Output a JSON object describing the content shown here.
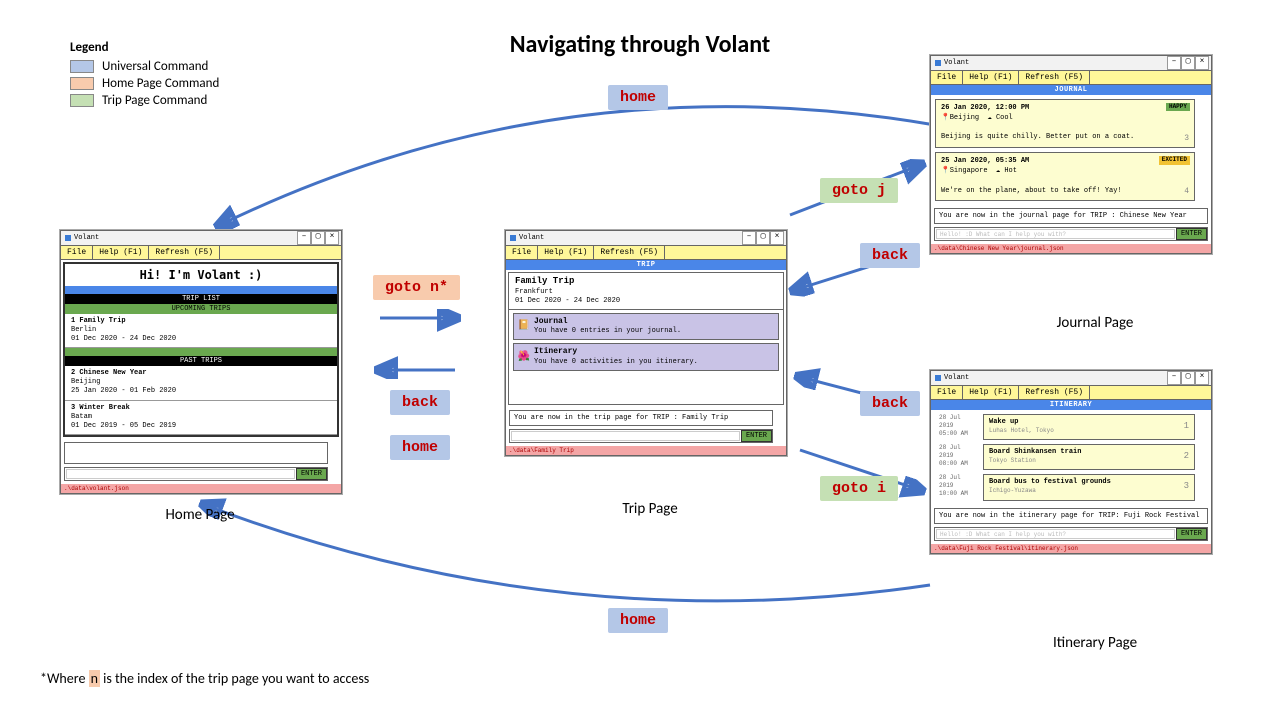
{
  "title": "Navigating through Volant",
  "legend": {
    "heading": "Legend",
    "items": [
      {
        "label": "Universal Command",
        "color": "#b4c7e7"
      },
      {
        "label": "Home Page Command",
        "color": "#f8cbad"
      },
      {
        "label": "Trip Page Command",
        "color": "#c5e0b4"
      }
    ]
  },
  "commands": {
    "home1": "home",
    "goto_n": "goto n*",
    "back1": "back",
    "home2": "home",
    "goto_j": "goto j",
    "back2": "back",
    "back3": "back",
    "goto_i": "goto i",
    "home3": "home"
  },
  "captions": {
    "home": "Home Page",
    "trip": "Trip Page",
    "journal": "Journal Page",
    "itin": "Itinerary Page"
  },
  "footnote": {
    "prefix": "*Where ",
    "n": "n",
    "suffix": " is the index of the trip page you want to access"
  },
  "app": {
    "name": "Volant",
    "menus": {
      "file": "File",
      "help": "Help (F1)",
      "refresh": "Refresh (F5)"
    },
    "enter": "ENTER"
  },
  "home_win": {
    "greeting": "Hi! I'm Volant :)",
    "trip_list": "TRIP LIST",
    "upcoming": "UPCOMING TRIPS",
    "past": "PAST TRIPS",
    "trips": [
      {
        "idx": "1",
        "name": "Family Trip",
        "place": "Berlin",
        "dates": "01 Dec 2020 - 24 Dec 2020"
      },
      {
        "idx": "2",
        "name": "Chinese New Year",
        "place": "Beijing",
        "dates": "25 Jan 2020 - 01 Feb 2020"
      },
      {
        "idx": "3",
        "name": "Winter Break",
        "place": "Batam",
        "dates": "01 Dec 2019 - 05 Dec 2019"
      }
    ],
    "path": ".\\data\\volant.json"
  },
  "trip_win": {
    "tab": "TRIP",
    "name": "Family Trip",
    "place": "Frankfurt",
    "dates": "01 Dec 2020 - 24 Dec 2020",
    "journal_title": "Journal",
    "journal_sub": "You have 0 entries in your journal.",
    "itin_title": "Itinerary",
    "itin_sub": "You have 0 activities in you itinerary.",
    "status": "You are now in the trip page for TRIP : Family Trip",
    "path": ".\\data\\Family Trip"
  },
  "journal_win": {
    "tab": "JOURNAL",
    "entries": [
      {
        "date": "26 Jan 2020, 12:00 PM",
        "loc": "Beijing",
        "weather": "Cool",
        "tag": "HAPPY",
        "tagcolor": "#6aa84f",
        "text": "Beijing is quite chilly. Better put on a coat.",
        "num": "3"
      },
      {
        "date": "25 Jan 2020, 05:35 AM",
        "loc": "Singapore",
        "weather": "Hot",
        "tag": "EXCITED",
        "tagcolor": "#f1c232",
        "text": "We're on the plane, about to take off! Yay!",
        "num": "4"
      }
    ],
    "status": "You are now in the journal page for TRIP : Chinese New Year",
    "placeholder": "Hello! :D What can I help you with?",
    "path": ".\\data\\Chinese New Year\\journal.json"
  },
  "itin_win": {
    "tab": "ITINERARY",
    "items": [
      {
        "date": "28 Jul 2019",
        "time": "05:00 AM",
        "title": "Wake up",
        "sub": "Luhas Hotel, Tokyo",
        "num": "1"
      },
      {
        "date": "28 Jul 2019",
        "time": "08:00 AM",
        "title": "Board Shinkansen train",
        "sub": "Tokyo Station",
        "num": "2"
      },
      {
        "date": "28 Jul 2019",
        "time": "10:00 AM",
        "title": "Board bus to festival grounds",
        "sub": "Ichigo-Yuzawa",
        "num": "3"
      }
    ],
    "status": "You are now in the itinerary page for TRIP: Fuji Rock Festival",
    "placeholder": "Hello! :D What can I help you with?",
    "path": ".\\data\\Fuji Rock Festival\\itinerary.json"
  }
}
